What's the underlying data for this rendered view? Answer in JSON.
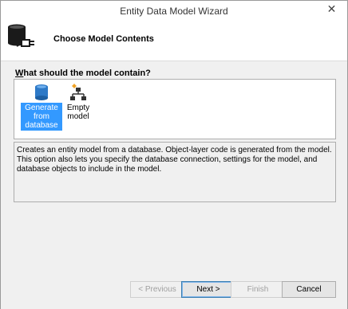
{
  "window": {
    "title": "Entity Data Model Wizard",
    "close_glyph": "✕"
  },
  "header": {
    "title": "Choose Model Contents"
  },
  "question": {
    "prefix": "W",
    "rest": "hat should the model contain?"
  },
  "choices": [
    {
      "label": "Generate from database",
      "icon": "database-icon",
      "selected": true
    },
    {
      "label": "Empty model",
      "icon": "model-hierarchy-icon",
      "selected": false
    }
  ],
  "description": "Creates an entity model from a database. Object-layer code is generated from the model. This option also lets you specify the database connection, settings for the model, and database objects to include in the model.",
  "buttons": {
    "previous": "< Previous",
    "next": "Next >",
    "finish": "Finish",
    "cancel": "Cancel"
  },
  "colors": {
    "selection": "#3399ff",
    "body_bg": "#f0f0f0",
    "default_border": "#3c7fb1"
  }
}
